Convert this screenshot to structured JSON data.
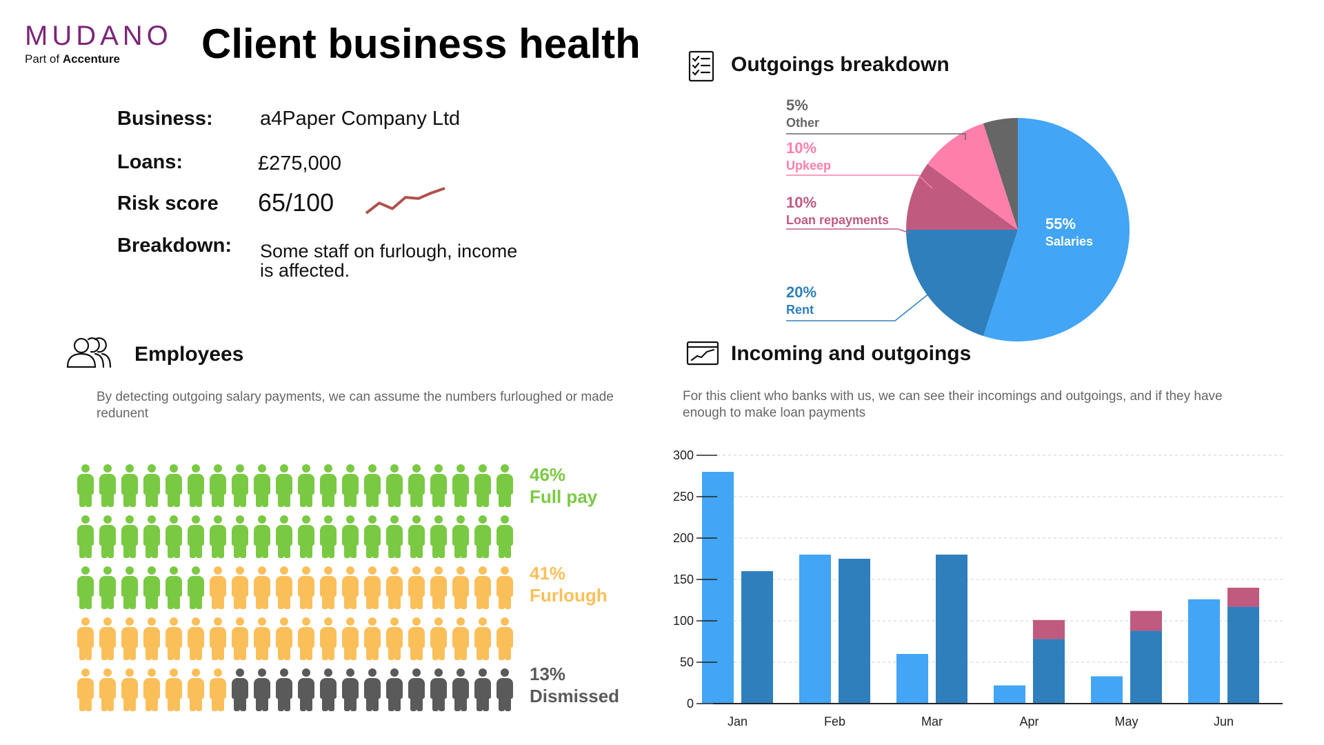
{
  "brand": {
    "name": "MUDANO",
    "sub_prefix": "Part of ",
    "sub_company": "Accenture"
  },
  "title": "Client business health",
  "info": {
    "business_label": "Business:",
    "business_value": "a4Paper Company Ltd",
    "loans_label": "Loans:",
    "loans_value": "£275,000",
    "risk_label": "Risk score",
    "risk_value": "65/100",
    "breakdown_label": "Breakdown:",
    "breakdown_value": "Some staff on furlough, income is affected."
  },
  "employees": {
    "title": "Employees",
    "description": "By detecting outgoing salary payments, we can assume the numbers furloughed or made redunent",
    "categories": [
      {
        "pct": "46%",
        "label": "Full pay",
        "color": "#7ac943",
        "count": 46
      },
      {
        "pct": "41%",
        "label": "Furlough",
        "color": "#fbbf5a",
        "count": 41
      },
      {
        "pct": "13%",
        "label": "Dismissed",
        "color": "#5a5a5a",
        "count": 13
      }
    ]
  },
  "outgoings": {
    "title": "Outgoings breakdown",
    "slices": [
      {
        "pct": "55%",
        "label": "Salaries",
        "value": 55,
        "color": "#42a5f5"
      },
      {
        "pct": "20%",
        "label": "Rent",
        "value": 20,
        "color": "#2e7fbc"
      },
      {
        "pct": "10%",
        "label": "Loan repayments",
        "value": 10,
        "color": "#c05a7e"
      },
      {
        "pct": "10%",
        "label": "Upkeep",
        "value": 10,
        "color": "#ff7fab"
      },
      {
        "pct": "5%",
        "label": "Other",
        "value": 5,
        "color": "#666666"
      }
    ]
  },
  "incoming": {
    "title": "Incoming and outgoings",
    "description": "For this client who banks with us, we can see their incomings and outgoings, and if they have enough to make loan payments"
  },
  "chart_data": [
    {
      "type": "pie",
      "title": "Outgoings breakdown",
      "categories": [
        "Salaries",
        "Rent",
        "Loan repayments",
        "Upkeep",
        "Other"
      ],
      "values": [
        55,
        20,
        10,
        10,
        5
      ]
    },
    {
      "type": "bar",
      "title": "Incoming and outgoings",
      "categories": [
        "Jan",
        "Feb",
        "Mar",
        "Apr",
        "May",
        "Jun"
      ],
      "series": [
        {
          "values": [
            280,
            180,
            60,
            22,
            33,
            126
          ],
          "color": "#42a5f5"
        },
        {
          "values": [
            160,
            175,
            180,
            78,
            88,
            117
          ],
          "color": "#2e7fbc"
        },
        {
          "values": [
            0,
            0,
            0,
            23,
            24,
            23
          ],
          "color": "#c05a7e"
        }
      ],
      "stacked_series": [
        1,
        2
      ],
      "ylim": [
        0,
        300
      ],
      "yticks": [
        0,
        50,
        100,
        150,
        200,
        250,
        300
      ],
      "grid": true,
      "xlabel": "",
      "ylabel": ""
    },
    {
      "type": "line",
      "title": "",
      "values": [
        0,
        9,
        4,
        14,
        13,
        18,
        22
      ],
      "color": "#b0514c"
    }
  ]
}
